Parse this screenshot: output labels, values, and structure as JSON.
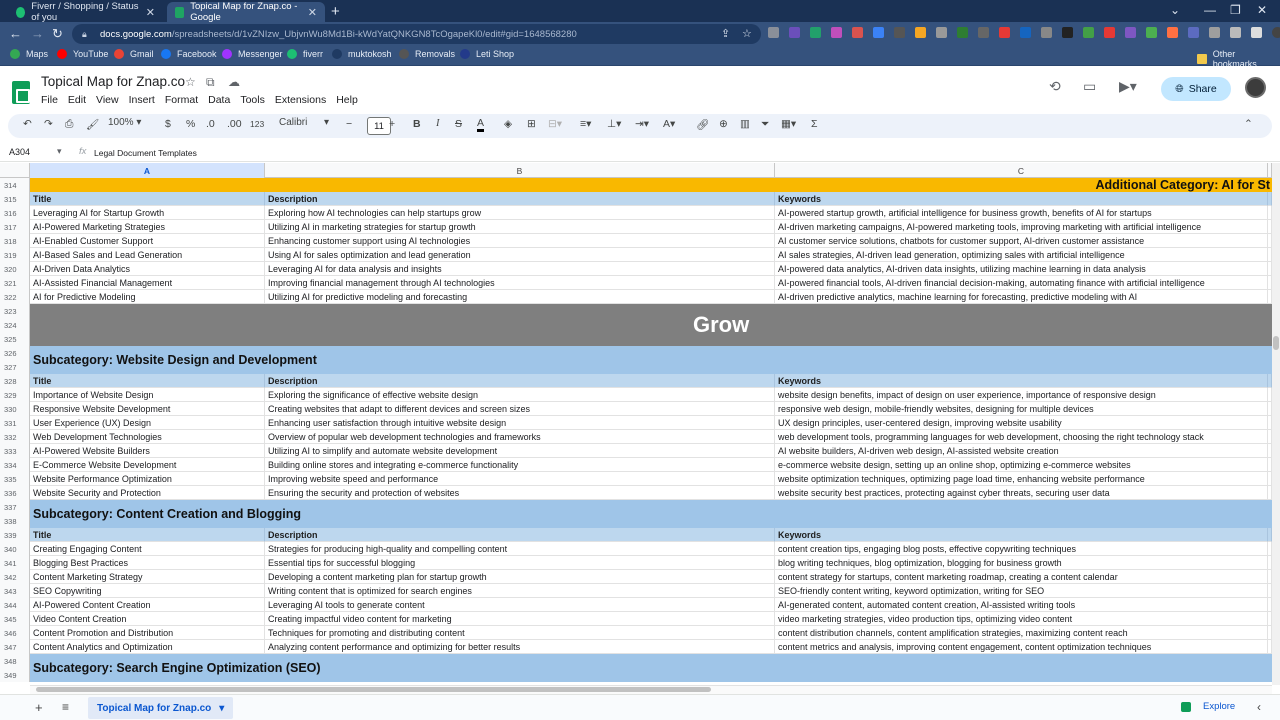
{
  "browser": {
    "tabs": [
      {
        "title": "Fiverr / Shopping / Status of you",
        "active": false
      },
      {
        "title": "Topical Map for Znap.co - Google",
        "active": true
      }
    ],
    "url_host": "docs.google.com",
    "url_path": "/spreadsheets/d/1vZNIzw_UbjvnWu8Md1Bi-kWdYatQNKGN8TcOgapeKl0/edit#gid=1648568280",
    "bookmarks": [
      {
        "label": "Maps",
        "color": "#34a853"
      },
      {
        "label": "YouTube",
        "color": "#ff0000"
      },
      {
        "label": "Gmail",
        "color": "#ea4335"
      },
      {
        "label": "Facebook",
        "color": "#1877f2"
      },
      {
        "label": "Messenger",
        "color": "#a033ff"
      },
      {
        "label": "fiverr",
        "color": "#1dbf73"
      },
      {
        "label": "muktokosh",
        "color": "#1f3a62"
      },
      {
        "label": "Removals",
        "color": "#555555"
      },
      {
        "label": "Leti Shop",
        "color": "#233a8a"
      }
    ],
    "other_bookmarks": "Other bookmarks"
  },
  "sheets": {
    "doc_title": "Topical Map for Znap.co",
    "menus": [
      "File",
      "Edit",
      "View",
      "Insert",
      "Format",
      "Data",
      "Tools",
      "Extensions",
      "Help"
    ],
    "share_label": "Share",
    "toolbar": {
      "zoom": "100%",
      "currency": "$",
      "percent": "%",
      "dec_decrease": ".0",
      "dec_increase": ".00",
      "number_format": "123",
      "font": "Calibri",
      "font_size": "11",
      "bold": "B",
      "italic": "I",
      "sigma": "Σ"
    },
    "name_box": "A304",
    "formula_content": "Legal Document Templates",
    "columns": [
      "A",
      "B",
      "C"
    ],
    "sheet_tab": "Topical Map for Znap.co",
    "explore_label": "Explore"
  },
  "grid": {
    "yellow_banner": "Additional Category: AI for St",
    "header_labels": [
      "Title",
      "Description",
      "Keywords"
    ],
    "grow_label": "Grow",
    "rows": [
      {
        "n": "314",
        "kind": "yellow"
      },
      {
        "n": "315",
        "kind": "header"
      },
      {
        "n": "316",
        "kind": "data",
        "a": "Leveraging AI for Startup Growth",
        "b": "Exploring how AI technologies can help startups grow",
        "c": "AI-powered startup growth, artificial intelligence for business growth, benefits of AI for startups"
      },
      {
        "n": "317",
        "kind": "data",
        "a": "AI-Powered Marketing Strategies",
        "b": "Utilizing AI in marketing strategies for startup growth",
        "c": "AI-driven marketing campaigns, AI-powered marketing tools, improving marketing with artificial intelligence"
      },
      {
        "n": "318",
        "kind": "data",
        "a": "AI-Enabled Customer Support",
        "b": "Enhancing customer support using AI technologies",
        "c": "AI customer service solutions, chatbots for customer support, AI-driven customer assistance"
      },
      {
        "n": "319",
        "kind": "data",
        "a": "AI-Based Sales and Lead Generation",
        "b": "Using AI for sales optimization and lead generation",
        "c": "AI sales strategies, AI-driven lead generation, optimizing sales with artificial intelligence"
      },
      {
        "n": "320",
        "kind": "data",
        "a": "AI-Driven Data Analytics",
        "b": "Leveraging AI for data analysis and insights",
        "c": "AI-powered data analytics, AI-driven data insights, utilizing machine learning in data analysis"
      },
      {
        "n": "321",
        "kind": "data",
        "a": "AI-Assisted Financial Management",
        "b": "Improving financial management through AI technologies",
        "c": "AI-powered financial tools, AI-driven financial decision-making, automating finance with artificial intelligence"
      },
      {
        "n": "322",
        "kind": "data",
        "a": "AI for Predictive Modeling",
        "b": "Utilizing AI for predictive modeling and forecasting",
        "c": "AI-driven predictive analytics, machine learning for forecasting, predictive modeling with AI"
      },
      {
        "n": "323",
        "kind": "grow_top"
      },
      {
        "n": "324",
        "kind": "grow"
      },
      {
        "n": "325",
        "kind": "grow_bottom"
      },
      {
        "n": "326",
        "kind": "sub",
        "label": "Subcategory: Website Design and Development"
      },
      {
        "n": "327",
        "kind": "sub_cont"
      },
      {
        "n": "328",
        "kind": "header"
      },
      {
        "n": "329",
        "kind": "data",
        "a": "Importance of Website Design",
        "b": "Exploring the significance of effective website design",
        "c": "website design benefits, impact of design on user experience, importance of responsive design"
      },
      {
        "n": "330",
        "kind": "data",
        "a": "Responsive Website Development",
        "b": "Creating websites that adapt to different devices and screen sizes",
        "c": "responsive web design, mobile-friendly websites, designing for multiple devices"
      },
      {
        "n": "331",
        "kind": "data",
        "a": "User Experience (UX) Design",
        "b": "Enhancing user satisfaction through intuitive website design",
        "c": "UX design principles, user-centered design, improving website usability"
      },
      {
        "n": "332",
        "kind": "data",
        "a": "Web Development Technologies",
        "b": "Overview of popular web development technologies and frameworks",
        "c": "web development tools, programming languages for web development, choosing the right technology stack"
      },
      {
        "n": "333",
        "kind": "data",
        "a": "AI-Powered Website Builders",
        "b": "Utilizing AI to simplify and automate website development",
        "c": "AI website builders, AI-driven web design, AI-assisted website creation"
      },
      {
        "n": "334",
        "kind": "data",
        "a": "E-Commerce Website Development",
        "b": "Building online stores and integrating e-commerce functionality",
        "c": "e-commerce website design, setting up an online shop, optimizing e-commerce websites"
      },
      {
        "n": "335",
        "kind": "data",
        "a": "Website Performance Optimization",
        "b": "Improving website speed and performance",
        "c": "website optimization techniques, optimizing page load time, enhancing website performance"
      },
      {
        "n": "336",
        "kind": "data",
        "a": "Website Security and Protection",
        "b": "Ensuring the security and protection of websites",
        "c": "website security best practices, protecting against cyber threats, securing user data"
      },
      {
        "n": "337",
        "kind": "sub",
        "label": "Subcategory: Content Creation and Blogging"
      },
      {
        "n": "338",
        "kind": "sub_cont"
      },
      {
        "n": "339",
        "kind": "header"
      },
      {
        "n": "340",
        "kind": "data",
        "a": "Creating Engaging Content",
        "b": "Strategies for producing high-quality and compelling content",
        "c": "content creation tips, engaging blog posts, effective copywriting techniques"
      },
      {
        "n": "341",
        "kind": "data",
        "a": "Blogging Best Practices",
        "b": "Essential tips for successful blogging",
        "c": "blog writing techniques, blog optimization, blogging for business growth"
      },
      {
        "n": "342",
        "kind": "data",
        "a": "Content Marketing Strategy",
        "b": "Developing a content marketing plan for startup growth",
        "c": "content strategy for startups, content marketing roadmap, creating a content calendar"
      },
      {
        "n": "343",
        "kind": "data",
        "a": "SEO Copywriting",
        "b": "Writing content that is optimized for search engines",
        "c": "SEO-friendly content writing, keyword optimization, writing for SEO"
      },
      {
        "n": "344",
        "kind": "data",
        "a": "AI-Powered Content Creation",
        "b": "Leveraging AI tools to generate content",
        "c": "AI-generated content, automated content creation, AI-assisted writing tools"
      },
      {
        "n": "345",
        "kind": "data",
        "a": "Video Content Creation",
        "b": "Creating impactful video content for marketing",
        "c": "video marketing strategies, video production tips, optimizing video content"
      },
      {
        "n": "346",
        "kind": "data",
        "a": "Content Promotion and Distribution",
        "b": "Techniques for promoting and distributing content",
        "c": "content distribution channels, content amplification strategies, maximizing content reach"
      },
      {
        "n": "347",
        "kind": "data",
        "a": "Content Analytics and Optimization",
        "b": "Analyzing content performance and optimizing for better results",
        "c": "content metrics and analysis, improving content engagement, content optimization techniques"
      },
      {
        "n": "348",
        "kind": "sub",
        "label": "Subcategory: Search Engine Optimization (SEO)"
      },
      {
        "n": "349",
        "kind": "sub_cont"
      }
    ]
  }
}
